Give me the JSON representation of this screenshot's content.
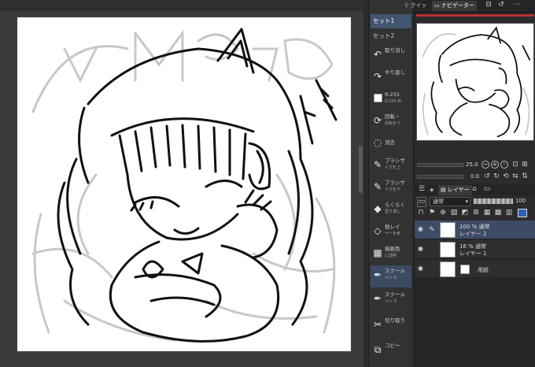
{
  "command_bar": {
    "sets": [
      "セット1",
      "セット2"
    ],
    "items": [
      {
        "label": "取り消し",
        "icon": "undo-icon",
        "glyph": "↶"
      },
      {
        "label": "やり直し",
        "icon": "redo-icon",
        "glyph": "↷"
      },
      {
        "label": "R:255",
        "sub": "G:255 B:",
        "icon": "color-swatch"
      },
      {
        "label": "回転・",
        "sub": "反転をリ",
        "icon": "rotate-icon",
        "glyph": "⟳"
      },
      {
        "label": "消去",
        "icon": "erase-icon",
        "glyph": "◌"
      },
      {
        "label": "ブラシサ",
        "sub": "イズを上",
        "icon": "brush-size-up-icon",
        "glyph": "✎"
      },
      {
        "label": "ブラシサ",
        "sub": "イズを下",
        "icon": "brush-size-down-icon",
        "glyph": "✎"
      },
      {
        "label": "らくらく",
        "sub": "塗り潰し",
        "icon": "fill-icon",
        "glyph": "◆"
      },
      {
        "label": "他レイ",
        "sub": "ヤーを参",
        "icon": "fill-ref-icon",
        "glyph": "◇"
      },
      {
        "label": "描画色",
        "sub": "に透明",
        "icon": "draw-color-icon",
        "glyph": "▦"
      },
      {
        "label": "スクール",
        "sub": "ペン 5",
        "icon": "pen-icon",
        "glyph": "✒"
      },
      {
        "label": "スクール",
        "sub": "ペン 3",
        "icon": "pen-icon",
        "glyph": "✒"
      },
      {
        "label": "切り取り",
        "icon": "cut-icon",
        "glyph": "✂"
      },
      {
        "label": "コピー",
        "icon": "copy-icon",
        "glyph": "⧉"
      }
    ]
  },
  "right_panel": {
    "top_tabs": {
      "quick": "クイッ",
      "navigator": "ナビゲーター"
    },
    "zoom": "25.0",
    "rotate": "0.0",
    "layer_tabs": {
      "layer": "レイヤー"
    },
    "blend_mode": "通常",
    "opacity": "100",
    "layers": [
      {
        "line1": "100 % 通常",
        "line2": "レイヤー 2"
      },
      {
        "line1": "16 % 通常",
        "line2": "レイヤー 1"
      },
      {
        "name": "用紙"
      }
    ]
  },
  "colors": {
    "selected_layer": "#3e4b66",
    "active_set": "#41556f",
    "navigator_bar": "#b83232"
  }
}
